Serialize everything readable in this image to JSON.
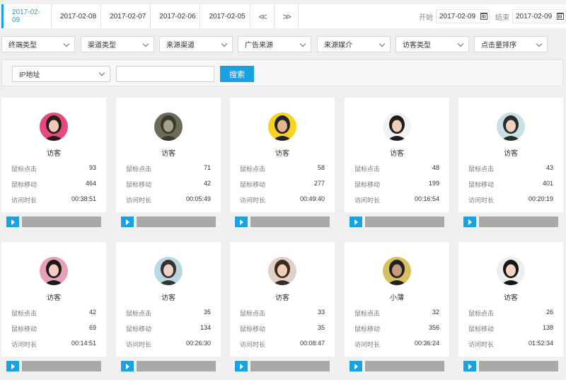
{
  "dates": {
    "tabs": [
      "2017-02-09",
      "2017-02-08",
      "2017-02-07",
      "2017-02-06",
      "2017-02-05"
    ],
    "active_index": 0,
    "prev_glyph": "<<",
    "next_glyph": ">>",
    "start_label": "开始",
    "start_value": "2017-02-09",
    "end_label": "结束",
    "end_value": "2017-02-09"
  },
  "filters": [
    "终端类型",
    "渠道类型",
    "来源渠道",
    "广告来源",
    "来源媒介",
    "访客类型",
    "点击量排序"
  ],
  "search": {
    "select_value": "IP地址",
    "input_value": "",
    "button_label": "搜索"
  },
  "labels": {
    "clicks": "鼠标点击",
    "moves": "鼠标移动",
    "duration": "访问时长"
  },
  "cards": [
    {
      "name": "访客",
      "clicks": "93",
      "moves": "464",
      "duration": "00:38:51"
    },
    {
      "name": "访客",
      "clicks": "71",
      "moves": "42",
      "duration": "00:05:49"
    },
    {
      "name": "访客",
      "clicks": "58",
      "moves": "277",
      "duration": "00:49:40"
    },
    {
      "name": "访客",
      "clicks": "48",
      "moves": "199",
      "duration": "00:16:54"
    },
    {
      "name": "访客",
      "clicks": "43",
      "moves": "401",
      "duration": "00:20:19"
    },
    {
      "name": "访客",
      "clicks": "42",
      "moves": "69",
      "duration": "00:14:51"
    },
    {
      "name": "访客",
      "clicks": "35",
      "moves": "134",
      "duration": "00:26:30"
    },
    {
      "name": "访客",
      "clicks": "33",
      "moves": "35",
      "duration": "00:08:47"
    },
    {
      "name": "小薄",
      "clicks": "32",
      "moves": "356",
      "duration": "00:36:24"
    },
    {
      "name": "访客",
      "clicks": "26",
      "moves": "138",
      "duration": "01:52:34"
    }
  ],
  "colors": {
    "accent": "#1aa1e1",
    "progress": "#a9a9a9"
  },
  "avatar_palettes": [
    [
      "#e64a7b",
      "#2a1a1a",
      "#f3c8b5"
    ],
    [
      "#6b6b5a",
      "#3b3a30",
      "#a8a28a"
    ],
    [
      "#f7d21e",
      "#222222",
      "#e8b48f"
    ],
    [
      "#f2f2f2",
      "#1e1e1e",
      "#efcdb8"
    ],
    [
      "#c8e0e6",
      "#2b2b2b",
      "#f0d0c0"
    ],
    [
      "#e8a0b8",
      "#1b1b1b",
      "#f3cdbd"
    ],
    [
      "#b8d8e4",
      "#3a3030",
      "#ead2c4"
    ],
    [
      "#e0d0c6",
      "#3a2a20",
      "#f0cdb8"
    ],
    [
      "#d8c060",
      "#202020",
      "#c99a7a"
    ],
    [
      "#eeeeee",
      "#151515",
      "#f2d4c4"
    ]
  ]
}
